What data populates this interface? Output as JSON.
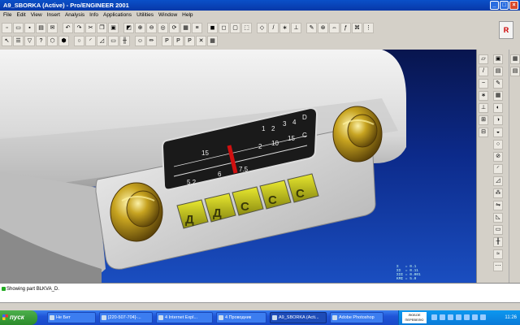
{
  "window": {
    "title": "A9_SBORKA (Active) - Pro/ENGINEER 2001"
  },
  "menu": [
    "File",
    "Edit",
    "View",
    "Insert",
    "Analysis",
    "Info",
    "Applications",
    "Utilities",
    "Window",
    "Help"
  ],
  "radio": {
    "buttons": [
      "Д",
      "Д",
      "С",
      "С",
      "С"
    ],
    "dial_top": [
      "1",
      "2",
      "3",
      "4",
      "D"
    ],
    "dial_mid": [
      "15",
      "2",
      "10",
      "15",
      "C"
    ],
    "dial_bot": [
      "5.2",
      "6",
      "7.5"
    ]
  },
  "coords": "Σ   = 0.1\nΣΣ  = 0.11\nΣΣΣ = 0.001\nΚΜΣ = 5.0",
  "message": {
    "text": "Showing part BLKVA_D."
  },
  "taskbar": {
    "start": "пуск",
    "tasks": [
      "Не Бит",
      "[220-507-704]-...",
      "4 Internet Expl...",
      "4 Проводник",
      "A9_SBORKA (Acti...",
      "Adobe Photoshop"
    ],
    "lang": "ЛЮБОЕ ПЕРЕВЕЛЮ",
    "clock": "11:26"
  }
}
